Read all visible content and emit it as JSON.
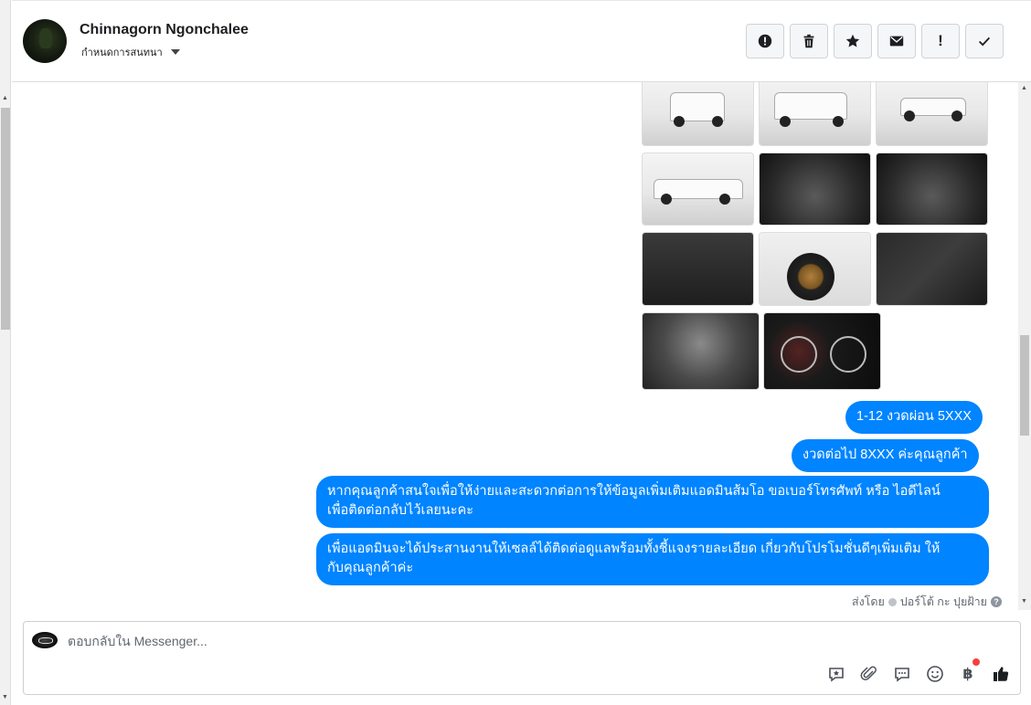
{
  "header": {
    "contact_name": "Chinnagorn Ngonchalee",
    "conversation_settings_label": "กำหนดการสนทนา",
    "toolbar": [
      "report-icon",
      "trash-icon",
      "star-icon",
      "envelope-icon",
      "priority-icon",
      "check-icon"
    ]
  },
  "messages": [
    {
      "text": "1-12 งวดผ่อน 5XXX"
    },
    {
      "text": "งวดต่อไป 8XXX  ค่ะคุณลูกค้า"
    },
    {
      "line1": "หากคุณลูกค้าสนใจเพื่อให้ง่ายและสะดวกต่อการให้ข้อมูลเพิ่มเติมแอดมินส้มโอ ขอเบอร์โทรศัพท์ หรือ ไอดีไลน์",
      "line2": "เพื่อติดต่อกลับไว้เลยนะคะ"
    },
    {
      "line1": "เพื่อแอดมินจะได้ประสานงานให้เซลล์ได้ติดต่อดูแลพร้อมทั้งชี้แจงรายละเอียด เกี่ยวกับโปรโมชั่นดีๆเพิ่มเติม ให้",
      "line2": "กับคุณลูกค้าค่ะ"
    }
  ],
  "sent_by": {
    "prefix": "ส่งโดย",
    "name": "ปอร์โต้ กะ ปุยฝ้าย",
    "help": "?"
  },
  "composer": {
    "placeholder": "ตอบกลับใน Messenger...",
    "tools": [
      "sticker-icon",
      "paperclip-icon",
      "saved-reply-icon",
      "emoji-icon",
      "baht-icon",
      "thumbs-up-icon"
    ],
    "baht_symbol": "฿"
  },
  "colors": {
    "bubble": "#0084ff",
    "badge": "#fa3e3e"
  }
}
